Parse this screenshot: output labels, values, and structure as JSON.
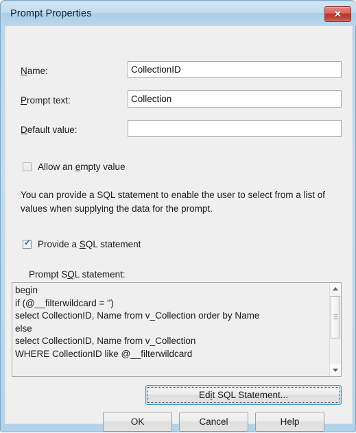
{
  "window": {
    "title": "Prompt Properties",
    "close_glyph": "✕",
    "frame_color": "#b8d5ea",
    "client_bg": "#efefef"
  },
  "fields": [
    {
      "label_pre": "",
      "label_accel": "N",
      "label_post": "ame:",
      "value": "CollectionID",
      "placeholder": ""
    },
    {
      "label_pre": "",
      "label_accel": "P",
      "label_post": "rompt text:",
      "value": "Collection",
      "placeholder": ""
    },
    {
      "label_pre": "",
      "label_accel": "D",
      "label_post": "efault value:",
      "value": "",
      "placeholder": ""
    }
  ],
  "checkboxes": {
    "allow_empty": {
      "label_pre": "Allow an ",
      "label_accel": "e",
      "label_post": "mpty value",
      "checked": false,
      "enabled": false
    },
    "provide_sql": {
      "label_pre": "Provide a ",
      "label_accel": "S",
      "label_post": "QL statement",
      "checked": true,
      "enabled": true,
      "check_glyph": "✔",
      "check_color": "#2c6ca8"
    }
  },
  "description": "You can provide a SQL statement to enable the user to select from a list of values when supplying the data for the prompt.",
  "sql_section": {
    "label_pre": "Prompt S",
    "label_accel": "Q",
    "label_post": "L statement:",
    "statement": "begin\nif (@__filterwildcard = '')\nselect CollectionID, Name from v_Collection order by Name\nelse\nselect CollectionID, Name from v_Collection\nWHERE CollectionID like @__filterwildcard",
    "scrollbar": {
      "up_arrow": "▲",
      "down_arrow": "▼",
      "thumb_position": "top"
    }
  },
  "buttons": {
    "edit_sql": {
      "label_pre": "Ed",
      "label_accel": "i",
      "label_post": "t SQL Statement...",
      "focused": true
    },
    "ok": {
      "label": "OK",
      "focused": false
    },
    "cancel": {
      "label": "Cancel",
      "focused": false
    },
    "help": {
      "label": "Help",
      "focused": false
    }
  }
}
